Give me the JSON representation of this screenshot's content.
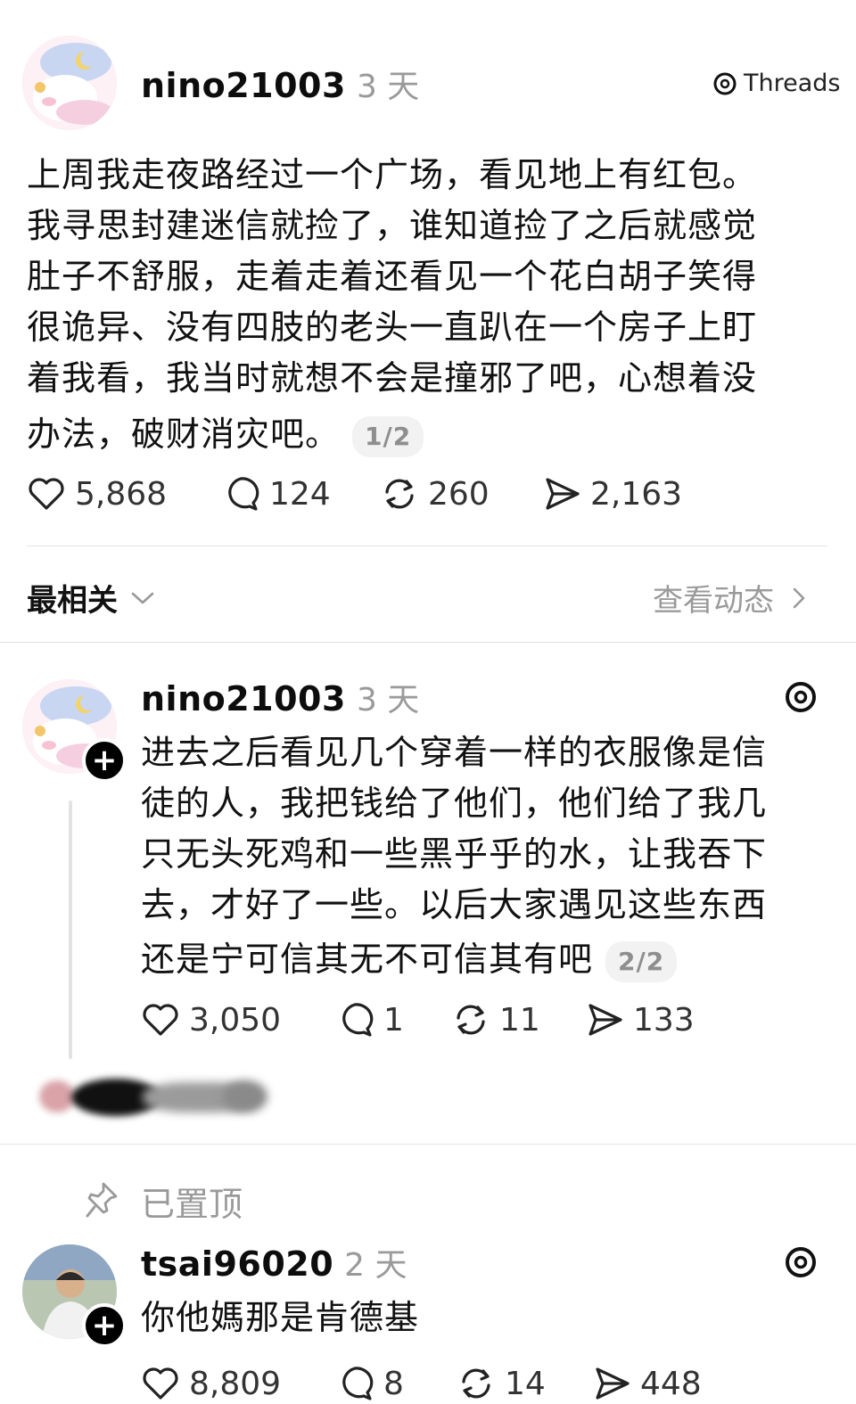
{
  "op_post": {
    "username": "nino21003",
    "time": "3 天",
    "brand": "Threads",
    "text_lines": [
      "上周我走夜路经过一个广场，看见地上有红包。",
      "我寻思封建迷信就捡了，谁知道捡了之后就感觉",
      "肚子不舒服，走着走着还看见一个花白胡子笑得",
      "很诡异、没有四肢的老头一直趴在一个房子上盯",
      "着我看，我当时就想不会是撞邪了吧，心想着没",
      "办法，破财消灾吧。"
    ],
    "page_badge": "1/2",
    "likes": "5,868",
    "comments": "124",
    "reposts": "260",
    "shares": "2,163"
  },
  "sort_bar": {
    "sort_label": "最相关",
    "activity_label": "查看动态"
  },
  "reply1": {
    "username": "nino21003",
    "time": "3 天",
    "text_lines": [
      "进去之后看见几个穿着一样的衣服像是信",
      "徒的人，我把钱给了他们，他们给了我几",
      "只无头死鸡和一些黑乎乎的水，让我吞下",
      "去，才好了一些。以后大家遇见这些东西",
      "还是宁可信其无不可信其有吧"
    ],
    "page_badge": "2/2",
    "likes": "3,050",
    "comments": "1",
    "reposts": "11",
    "shares": "133"
  },
  "pinned": {
    "label": "已置顶"
  },
  "reply2": {
    "username": "tsai96020",
    "time": "2 天",
    "text": "你他媽那是肯德基",
    "likes": "8,809",
    "comments": "8",
    "reposts": "14",
    "shares": "448"
  },
  "colors": {
    "muted": "#9a9a9a",
    "divider": "#e3e3e3",
    "text": "#111111"
  }
}
